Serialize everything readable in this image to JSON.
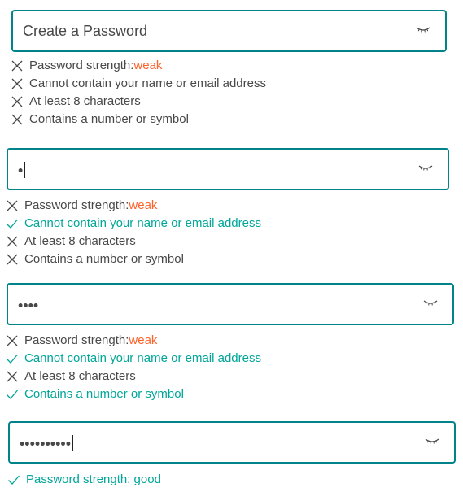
{
  "colors": {
    "border": "#008489",
    "pass": "#00A699",
    "fail": "#484848",
    "weak": "#FC642D"
  },
  "states": [
    {
      "input_value": "Create a Password",
      "is_placeholder": true,
      "show_caret": false,
      "eye_icon": "eye-closed-icon",
      "rules": [
        {
          "status": "fail",
          "label": "Password strength: ",
          "value": "weak"
        },
        {
          "status": "fail",
          "label": "Cannot contain your name or email address"
        },
        {
          "status": "fail",
          "label": "At least 8 characters"
        },
        {
          "status": "fail",
          "label": "Contains a number or symbol"
        }
      ]
    },
    {
      "input_value": "•",
      "is_placeholder": false,
      "show_caret": true,
      "eye_icon": "eye-closed-icon",
      "rules": [
        {
          "status": "fail",
          "label": "Password strength: ",
          "value": "weak"
        },
        {
          "status": "pass",
          "label": "Cannot contain your name or email address"
        },
        {
          "status": "fail",
          "label": "At least 8 characters"
        },
        {
          "status": "fail",
          "label": "Contains a number or symbol"
        }
      ]
    },
    {
      "input_value": "••••",
      "is_placeholder": false,
      "show_caret": false,
      "eye_icon": "eye-closed-icon",
      "rules": [
        {
          "status": "fail",
          "label": "Password strength: ",
          "value": "weak"
        },
        {
          "status": "pass",
          "label": "Cannot contain your name or email address"
        },
        {
          "status": "fail",
          "label": "At least 8 characters"
        },
        {
          "status": "pass",
          "label": "Contains a number or symbol"
        }
      ]
    },
    {
      "input_value": "••••••••••",
      "is_placeholder": false,
      "show_caret": true,
      "eye_icon": "eye-closed-icon",
      "rules": [
        {
          "status": "pass",
          "label": "Password strength: good"
        }
      ]
    }
  ]
}
